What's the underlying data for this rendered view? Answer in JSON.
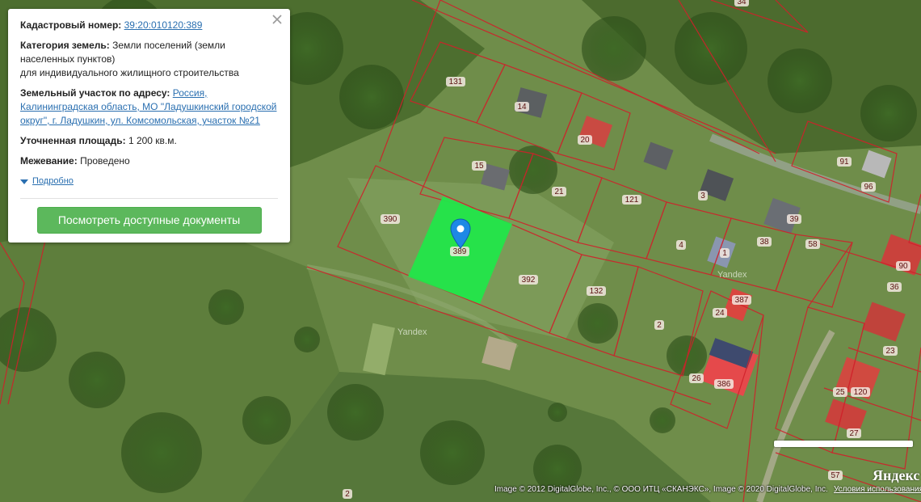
{
  "popup": {
    "cadastral_label": "Кадастровый номер:",
    "cadastral_value": "39:20:010120:389",
    "category_label": "Категория земель:",
    "category_value_1": "Земли поселений (земли",
    "category_value_2": "населенных пунктов)",
    "category_value_3": "для индивидуального жилищного строительства",
    "address_label": "Земельный участок по адресу:",
    "address_value_1": "Россия,",
    "address_value_2": "Калининградская область, МО \"Ладушкинский городской",
    "address_value_3": "округ\", г. Ладушкин, ул. Комсомольская, участок №21",
    "area_label": "Уточненная площадь:",
    "area_value": "1 200 кв.м.",
    "survey_label": "Межевание:",
    "survey_value": "Проведено",
    "more_link": "Подробно",
    "docs_button": "Посмотреть доступные документы"
  },
  "map": {
    "parcel_labels": [
      "34",
      "131",
      "14",
      "20",
      "15",
      "21",
      "121",
      "3",
      "91",
      "96",
      "390",
      "389",
      "392",
      "132",
      "4",
      "1",
      "38",
      "39",
      "58",
      "90",
      "36",
      "24",
      "387",
      "2",
      "23",
      "26",
      "386",
      "25",
      "120",
      "27",
      "57",
      "2"
    ],
    "watermarks": [
      "Yandex",
      "Yandex"
    ],
    "selected_parcel_color": "#22e64a",
    "boundary_color": "#d0202a"
  },
  "footer": {
    "copyright": "Image © 2012 DigitalGlobe, Inc., © ООО ИТЦ «СКАНЭКС», Image © 2020 DigitalGlobe, Inc.",
    "terms": "Условия использования",
    "logo": "Яндекс"
  }
}
